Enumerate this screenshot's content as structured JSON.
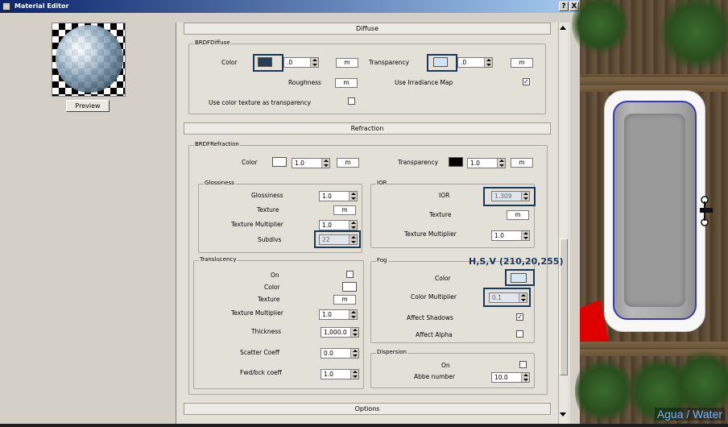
{
  "window": {
    "title": "Material Editor",
    "help_label": "?",
    "close_label": "X"
  },
  "preview": {
    "button_label": "Preview"
  },
  "sections": {
    "diffuse": "Diffuse",
    "refraction": "Refraction",
    "options": "Options"
  },
  "brdf_diffuse": {
    "group_title": "BRDFDiffuse",
    "color_label": "Color",
    "color_value": ".0",
    "color_map": "m",
    "transparency_label": "Transparency",
    "transparency_value": ".0",
    "transparency_map": "m",
    "roughness_label": "Roughness",
    "roughness_map": "m",
    "irradiance_label": "Use Irradiance Map",
    "irradiance_checked": true,
    "color_tex_transp_label": "Use color texture as transparency",
    "color_tex_transp_checked": false,
    "color_swatch": "#263d54",
    "transparency_swatch": "#d2e4f4"
  },
  "brdf_refraction": {
    "group_title": "BRDFRefraction",
    "color_label": "Color",
    "color_value": "1.0",
    "color_map": "m",
    "transparency_label": "Transparency",
    "transparency_value": "1.0",
    "transparency_map": "m",
    "color_swatch": "#ffffff",
    "transparency_swatch": "#000000"
  },
  "glossiness": {
    "group_title": "Glossiness",
    "glossiness_label": "Glossiness",
    "glossiness_value": "1.0",
    "texture_label": "Texture",
    "texture_map": "m",
    "tex_mult_label": "Texture Multiplier",
    "tex_mult_value": "1.0",
    "subdivs_label": "Subdivs",
    "subdivs_value": "22"
  },
  "ior": {
    "group_title": "IOR",
    "ior_label": "IOR",
    "ior_value": "1.309",
    "texture_label": "Texture",
    "texture_map": "m",
    "tex_mult_label": "Texture Multiplier",
    "tex_mult_value": "1.0"
  },
  "translucency": {
    "group_title": "Translucency",
    "on_label": "On",
    "on_checked": false,
    "color_label": "Color",
    "texture_label": "Texture",
    "texture_map": "m",
    "tex_mult_label": "Texture Multiplier",
    "tex_mult_value": "1.0",
    "thickness_label": "Thickness",
    "thickness_value": "1,000.0",
    "scatter_label": "Scatter Coeff",
    "scatter_value": "0.0",
    "fwdbck_label": "Fwd/bck coeff",
    "fwdbck_value": "1.0",
    "color_swatch": "#ffffff"
  },
  "fog": {
    "group_title": "Fog",
    "color_label": "Color",
    "color_mult_label": "Color Multiplier",
    "color_mult_value": "0.1",
    "affect_shadows_label": "Affect Shadows",
    "affect_shadows_checked": true,
    "affect_alpha_label": "Affect Alpha",
    "affect_alpha_checked": false,
    "color_swatch": "#d2e6f6"
  },
  "dispersion": {
    "group_title": "Dispersion",
    "on_label": "On",
    "on_checked": false,
    "abbe_label": "Abbe number",
    "abbe_value": "10.0"
  },
  "annotation": "H,S,V (210,20,255)",
  "scene_caption": "Agua / Water",
  "check_mark": "✓"
}
